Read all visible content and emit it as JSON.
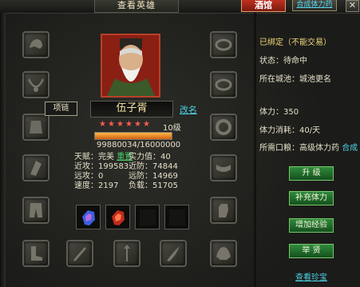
{
  "window": {
    "title": "查看英雄",
    "tavern_button": "酒馆",
    "synthesize_button": "合成体力药",
    "close_symbol": "✕"
  },
  "tooltip": "项链",
  "hero": {
    "name": "伍子胥",
    "rename_link": "改名",
    "stars": 6,
    "level": "10级",
    "exp_text": "99880034/16000000",
    "exp_progress": 1.0
  },
  "stats": {
    "talent_label": "天赋：",
    "talent_value": "完美",
    "reset_link": "重置",
    "power": "实力值：40",
    "melee_attack": "近攻：199583",
    "melee_defense": "近防：74844",
    "ranged_attack": "远攻：0",
    "ranged_defense": "远防：14969",
    "speed": "速度：2197",
    "load": "负载：51705"
  },
  "info": {
    "bound": "已绑定（不能交易）",
    "status": "状态：待命中",
    "city": "所在城池：城池更名",
    "stamina": "体力：350",
    "stamina_cost": "体力消耗：40/天",
    "required_item_label": "所需口粮：高级体力药",
    "required_item_link": "合成"
  },
  "buttons": {
    "upgrade": "升 级",
    "replenish": "补充体力",
    "add_exp": "增加经验",
    "dismiss": "举 贤",
    "view_treasure": "查看珍宝"
  },
  "colors": {
    "accent_cyan": "#4dd0e6",
    "star_red": "#ff5a52",
    "green_button": "#2f8a3c",
    "tavern_red": "#c0301f"
  },
  "equipment_icons": {
    "left": [
      "helmet-icon",
      "necklace-icon",
      "armor-icon",
      "bracer-icon",
      "pants-icon",
      "boots-icon"
    ],
    "right": [
      "ring-icon",
      "ring-icon",
      "bracelet-icon",
      "belt-icon",
      "gauntlet-icon",
      "shoulder-icon"
    ],
    "bottom": [
      "weapon-icon",
      "blade-icon",
      "mace-icon",
      "spear-icon",
      "bow-icon",
      "shield-icon"
    ]
  },
  "gem_icons": [
    "blue-crystal-icon",
    "red-crystal-icon",
    "empty-gem-slot-icon",
    "empty-gem-slot-icon"
  ]
}
